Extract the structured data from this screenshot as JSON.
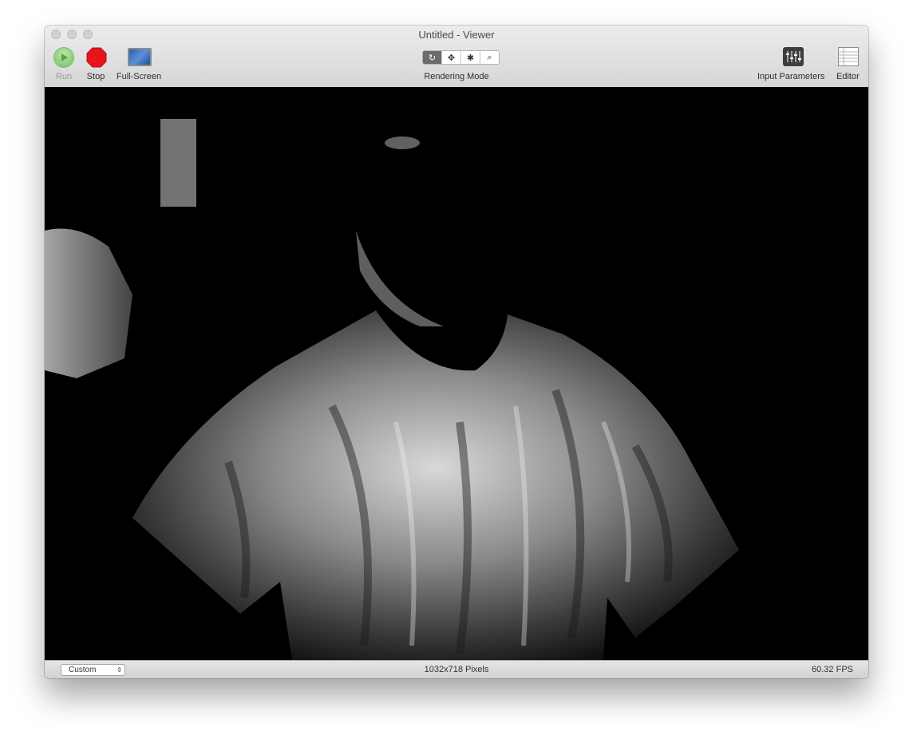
{
  "window": {
    "title": "Untitled - Viewer"
  },
  "toolbar": {
    "run_label": "Run",
    "stop_label": "Stop",
    "fullscreen_label": "Full-Screen",
    "rendering_mode_label": "Rendering Mode",
    "rendering_modes": [
      {
        "icon": "refresh-icon",
        "glyph": "↻",
        "active": true
      },
      {
        "icon": "move-icon",
        "glyph": "✥",
        "active": false
      },
      {
        "icon": "bug-icon",
        "glyph": "✱",
        "active": false
      },
      {
        "icon": "magnifier-icon",
        "glyph": "⌕",
        "active": false
      }
    ],
    "input_parameters_label": "Input Parameters",
    "editor_label": "Editor"
  },
  "statusbar": {
    "preset": "Custom",
    "dimensions": "1032x718 Pixels",
    "fps": "60.32 FPS"
  },
  "colors": {
    "viewport_bg": "#000000",
    "stop_red": "#e8141c",
    "run_green": "#6fc35d"
  }
}
